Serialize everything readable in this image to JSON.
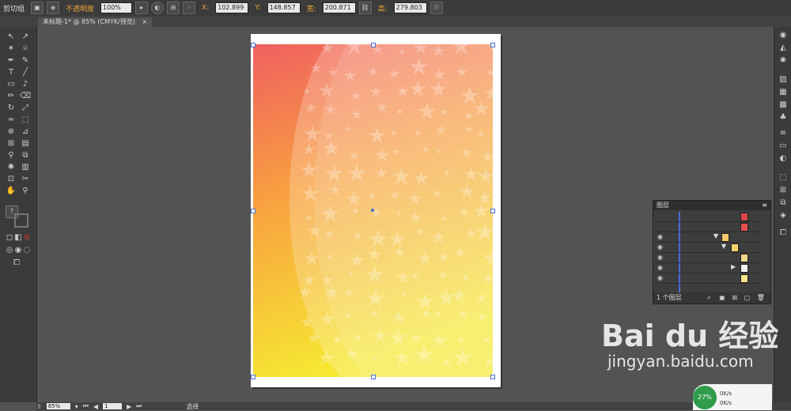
{
  "topbar": {
    "group_label": "剪切组",
    "opacity_label": "不透明度",
    "opacity_value": "100%",
    "x_label": "X:",
    "x_value": "102.899",
    "y_label": "Y:",
    "y_value": "148.857",
    "w_label": "宽:",
    "w_value": "200.871",
    "h_label": "高:",
    "h_value": "279.803"
  },
  "document": {
    "tab_title": "未标题-1* @ 85% (CMYK/预览)",
    "close_symbol": "×"
  },
  "layers_panel": {
    "title": "图层",
    "footer_label": "1 个图层",
    "rows": [
      {
        "swatch_color": "#d84848"
      },
      {
        "swatch_color": "#e74e4e"
      },
      {
        "swatch_color": "#f5c86a"
      },
      {
        "swatch_color": "#f6d16b"
      },
      {
        "swatch_color": "#f2d98a"
      },
      {
        "swatch_color": "#f0f0f0"
      },
      {
        "swatch_color": "#f7e58b"
      }
    ]
  },
  "status_bar": {
    "zoom": "85%",
    "page": "1",
    "mode": "选择"
  },
  "watermark": {
    "line1": "Bai du 经验",
    "line2": "jingyan.baidu.com"
  },
  "network_widget": {
    "percent": "27%",
    "upload": "0K/s",
    "download": "0K/s"
  },
  "colors": {
    "gradient_top": "#f06060",
    "gradient_mid": "#f8a040",
    "gradient_bottom": "#f6e832"
  }
}
